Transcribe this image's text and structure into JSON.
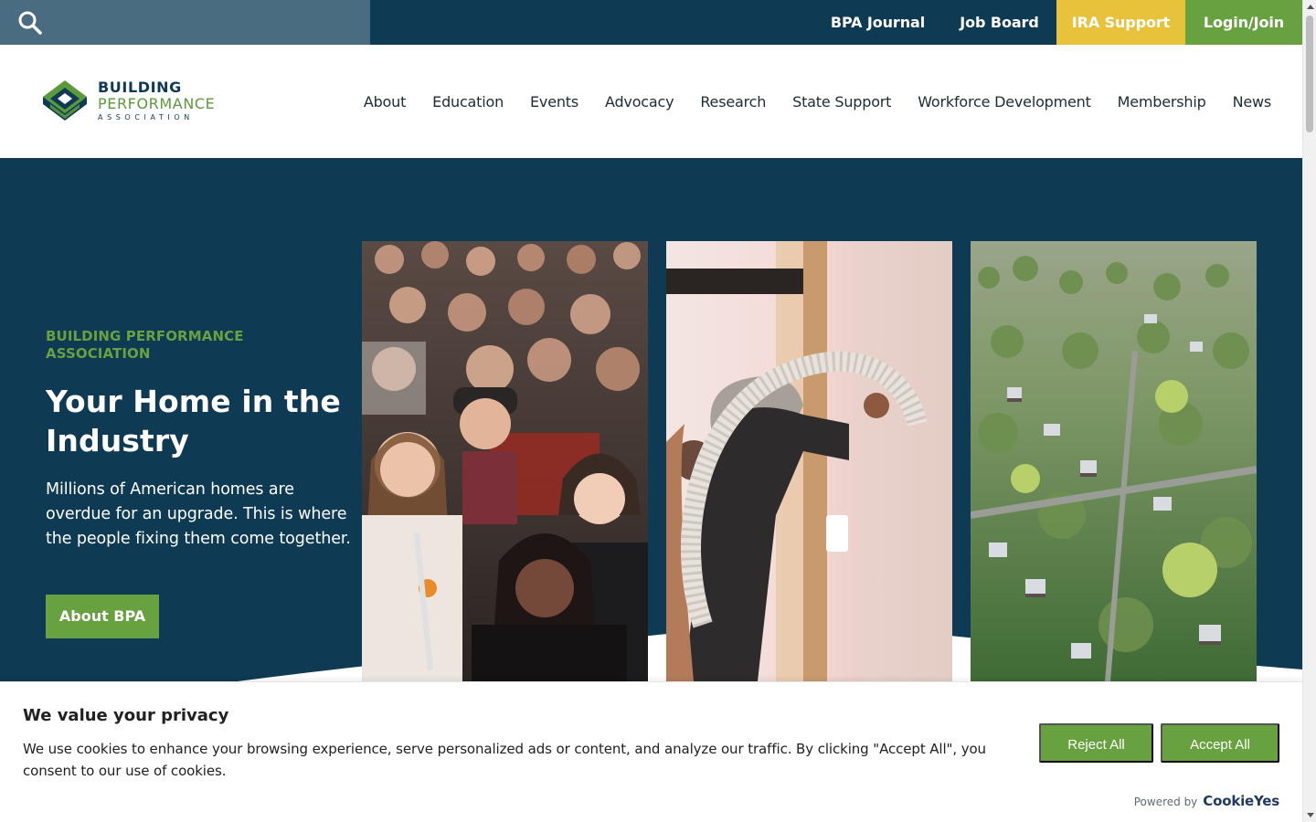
{
  "topbar": {
    "search_icon": "search-icon",
    "links": {
      "journal": "BPA Journal",
      "jobs": "Job Board",
      "ira": "IRA Support",
      "login": "Login/Join"
    },
    "colors": {
      "bar": "#0f3a53",
      "search": "#496c81",
      "ira": "#e9c23b",
      "login": "#68a13f"
    }
  },
  "logo": {
    "line1": "BUILDING",
    "line2": "PERFORMANCE",
    "line3": "ASSOCIATION"
  },
  "nav": {
    "items": [
      "About",
      "Education",
      "Events",
      "Advocacy",
      "Research",
      "State Support",
      "Workforce Development",
      "Membership",
      "News"
    ]
  },
  "hero": {
    "eyebrow": "BUILDING PERFORMANCE ASSOCIATION",
    "title": "Your Home in the Industry",
    "body": "Millions of American homes are overdue for an upgrade. This is where the people fixing them come together.",
    "button": "About BPA",
    "photos": [
      "conference-crowd-photo",
      "insulation-installer-photo",
      "aerial-neighborhood-photo"
    ]
  },
  "cookie": {
    "title": "We value your privacy",
    "text": "We use cookies to enhance your browsing experience, serve personalized ads or content, and analyze our traffic. By clicking \"Accept All\", you consent to our use of cookies.",
    "reject": "Reject All",
    "accept": "Accept All",
    "powered_label": "Powered by",
    "powered_brand": "CookieYes"
  },
  "colors": {
    "navy": "#0f3a53",
    "green": "#68a13f"
  }
}
